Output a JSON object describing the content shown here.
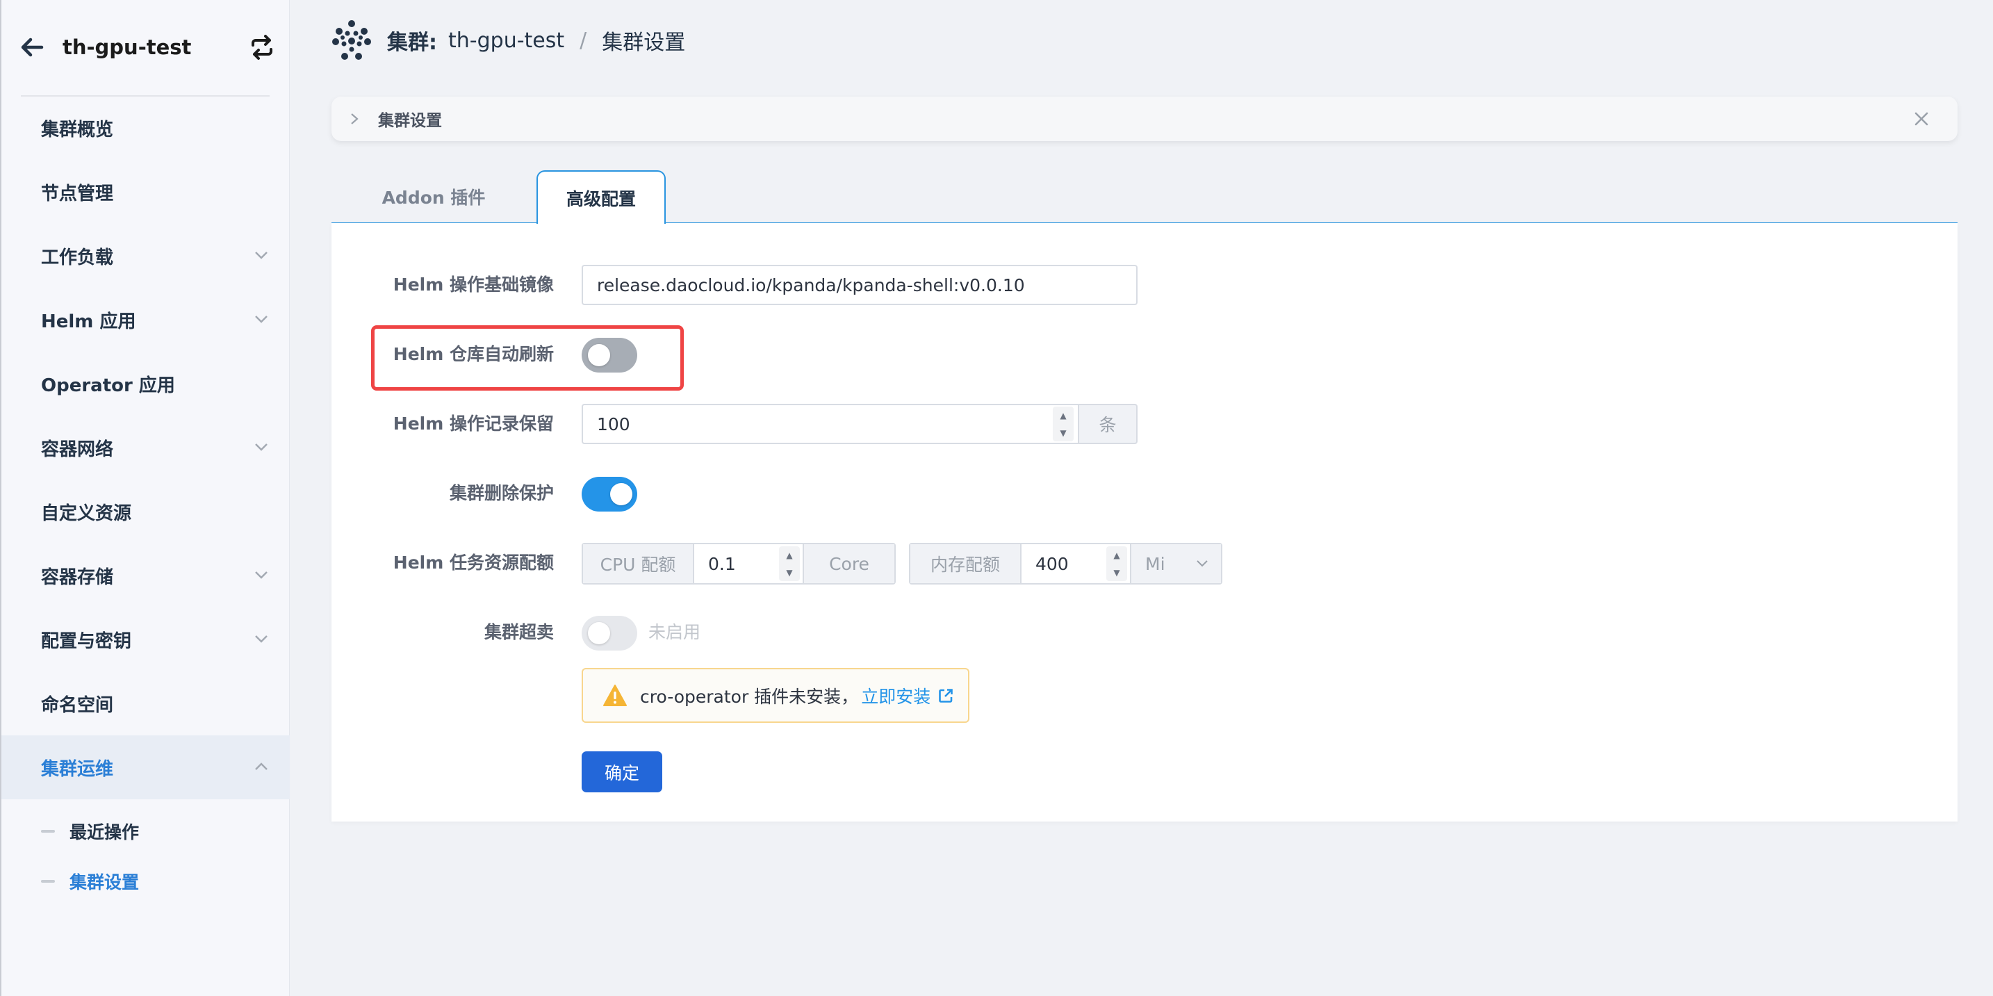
{
  "sidebar": {
    "cluster_name": "th-gpu-test",
    "items": [
      {
        "label": "集群概览",
        "has_children": false
      },
      {
        "label": "节点管理",
        "has_children": false
      },
      {
        "label": "工作负载",
        "has_children": true
      },
      {
        "label": "Helm 应用",
        "has_children": true
      },
      {
        "label": "Operator 应用",
        "has_children": false
      },
      {
        "label": "容器网络",
        "has_children": true
      },
      {
        "label": "自定义资源",
        "has_children": false
      },
      {
        "label": "容器存储",
        "has_children": true
      },
      {
        "label": "配置与密钥",
        "has_children": true
      },
      {
        "label": "命名空间",
        "has_children": false
      },
      {
        "label": "集群运维",
        "has_children": true,
        "expanded": true,
        "active": true
      }
    ],
    "sub_items": [
      {
        "label": "最近操作",
        "active": false
      },
      {
        "label": "集群设置",
        "active": true
      }
    ]
  },
  "header": {
    "cluster_label": "集群:",
    "cluster_name": "th-gpu-test",
    "separator": "/",
    "page": "集群设置"
  },
  "hint_bar": {
    "text": "集群设置"
  },
  "tabs": [
    {
      "label": "Addon 插件",
      "active": false
    },
    {
      "label": "高级配置",
      "active": true
    }
  ],
  "form": {
    "base_image": {
      "label": "Helm 操作基础镜像",
      "value": "release.daocloud.io/kpanda/kpanda-shell:v0.0.10"
    },
    "auto_refresh": {
      "label": "Helm 仓库自动刷新",
      "enabled": false
    },
    "history_retention": {
      "label": "Helm 操作记录保留",
      "value": "100",
      "unit": "条"
    },
    "delete_protection": {
      "label": "集群删除保护",
      "enabled": true
    },
    "task_resources": {
      "label": "Helm 任务资源配额",
      "cpu_label": "CPU 配额",
      "cpu_value": "0.1",
      "cpu_unit": "Core",
      "mem_label": "内存配额",
      "mem_value": "400",
      "mem_unit": "Mi"
    },
    "oversell": {
      "label": "集群超卖",
      "enabled": false,
      "status_text": "未启用"
    },
    "warning": {
      "text": "cro-operator 插件未安装，",
      "link": "立即安装"
    },
    "submit_label": "确定"
  },
  "colors": {
    "accent": "#2494e8",
    "primary_button": "#2367d9",
    "highlight_border": "#ef4444",
    "warning_border": "#f8d68e",
    "active_nav": "#2b7fd6"
  }
}
